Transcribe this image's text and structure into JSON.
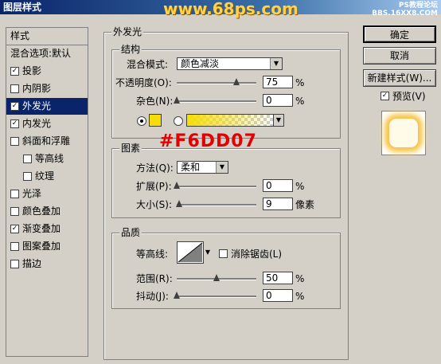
{
  "window": {
    "title": "图层样式",
    "watermark": "www.68ps.com",
    "watermark_small": "PS教程论坛\nBBS.16XX8.COM"
  },
  "styles_panel": {
    "header": "样式",
    "items": [
      {
        "label": "混合选项:默认",
        "checked": null,
        "indent": 0,
        "selected": false
      },
      {
        "label": "投影",
        "checked": true,
        "indent": 0,
        "selected": false
      },
      {
        "label": "内阴影",
        "checked": false,
        "indent": 0,
        "selected": false
      },
      {
        "label": "外发光",
        "checked": true,
        "indent": 0,
        "selected": true
      },
      {
        "label": "内发光",
        "checked": true,
        "indent": 0,
        "selected": false
      },
      {
        "label": "斜面和浮雕",
        "checked": false,
        "indent": 0,
        "selected": false
      },
      {
        "label": "等高线",
        "checked": false,
        "indent": 1,
        "selected": false
      },
      {
        "label": "纹理",
        "checked": false,
        "indent": 1,
        "selected": false
      },
      {
        "label": "光泽",
        "checked": false,
        "indent": 0,
        "selected": false
      },
      {
        "label": "颜色叠加",
        "checked": false,
        "indent": 0,
        "selected": false
      },
      {
        "label": "渐变叠加",
        "checked": true,
        "indent": 0,
        "selected": false
      },
      {
        "label": "图案叠加",
        "checked": false,
        "indent": 0,
        "selected": false
      },
      {
        "label": "描边",
        "checked": false,
        "indent": 0,
        "selected": false
      }
    ]
  },
  "outer_glow": {
    "title": "外发光",
    "structure": {
      "title": "结构",
      "blend_mode_label": "混合模式:",
      "blend_mode_value": "颜色减淡",
      "opacity_label": "不透明度(O):",
      "opacity_value": "75",
      "opacity_level": 75,
      "noise_label": "杂色(N):",
      "noise_value": "0",
      "noise_level": 0,
      "unit": "%",
      "color": "#f6dd07"
    },
    "elements": {
      "title": "图素",
      "method_label": "方法(Q):",
      "method_value": "柔和",
      "spread_label": "扩展(P):",
      "spread_value": "0",
      "spread_level": 0,
      "size_label": "大小(S):",
      "size_value": "9",
      "size_level": 3,
      "unit_pct": "%",
      "unit_px": "像素"
    },
    "quality": {
      "title": "品质",
      "contour_label": "等高线:",
      "antialias_label": "消除锯齿(L)",
      "range_label": "范围(R):",
      "range_value": "50",
      "range_level": 50,
      "jitter_label": "抖动(J):",
      "jitter_value": "0",
      "jitter_level": 0,
      "unit": "%"
    }
  },
  "annotation": {
    "color_code": "#F6DD07"
  },
  "buttons": {
    "ok": "确定",
    "cancel": "取消",
    "new_style": "新建样式(W)...",
    "preview": "预览(V)"
  }
}
